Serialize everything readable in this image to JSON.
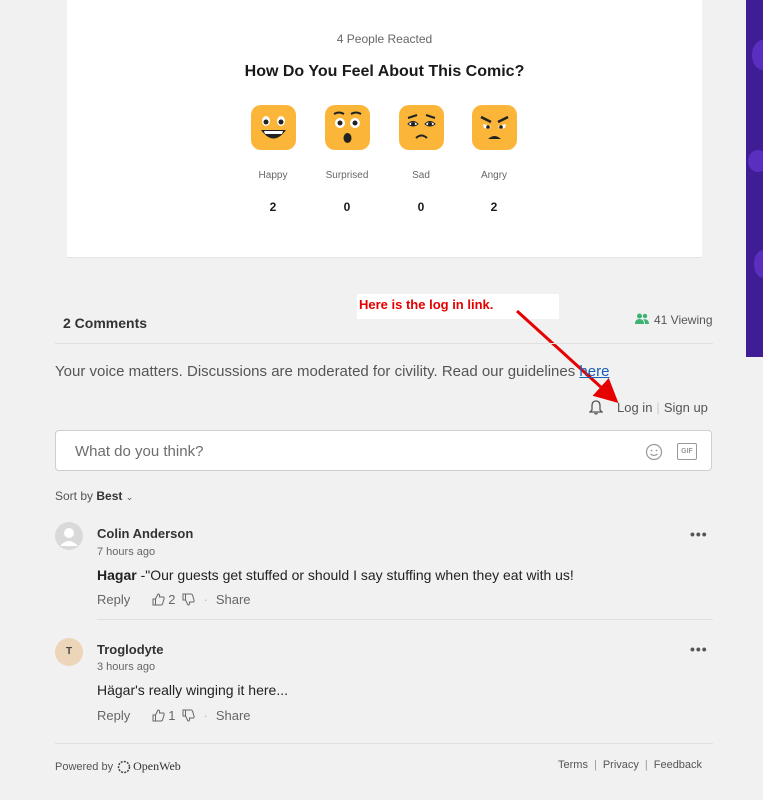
{
  "reactions": {
    "people_reacted": "4 People Reacted",
    "question": "How Do You Feel About This Comic?",
    "items": [
      {
        "label": "Happy",
        "count": "2",
        "icon": "happy-emoji-icon"
      },
      {
        "label": "Surprised",
        "count": "0",
        "icon": "surprised-emoji-icon"
      },
      {
        "label": "Sad",
        "count": "0",
        "icon": "sad-emoji-icon"
      },
      {
        "label": "Angry",
        "count": "2",
        "icon": "angry-emoji-icon"
      }
    ]
  },
  "annotation": {
    "text": "Here is the log in link.",
    "color": "#e60000"
  },
  "comments_header": {
    "title": "2 Comments",
    "viewing": "41 Viewing"
  },
  "guidelines": {
    "text": "Your voice matters. Discussions are moderated for civility. Read our guidelines ",
    "link": "here"
  },
  "auth": {
    "login": "Log in",
    "signup": "Sign up"
  },
  "comment_input": {
    "placeholder": "What do you think?",
    "gif_label": "GIF"
  },
  "sort": {
    "prefix": "Sort by",
    "value": "Best"
  },
  "comments": [
    {
      "author": "Colin Anderson",
      "time": "7 hours ago",
      "bold": "Hagar",
      "text": " -\"Our guests get stuffed or should I say stuffing when they eat with us!",
      "reply": "Reply",
      "likes": "2",
      "share": "Share"
    },
    {
      "author": "Troglodyte",
      "avatar_letter": "T",
      "time": "3 hours ago",
      "text": "Hägar's really winging it here...",
      "reply": "Reply",
      "likes": "1",
      "share": "Share"
    }
  ],
  "footer": {
    "powered_by": "Powered by",
    "brand": "OpenWeb",
    "links": [
      "Terms",
      "Privacy",
      "Feedback"
    ]
  },
  "colors": {
    "accent": "#fbb63a",
    "viewing_icon": "#3cb371",
    "link": "#1a5bb5",
    "side_bar": "#3f1d94"
  }
}
